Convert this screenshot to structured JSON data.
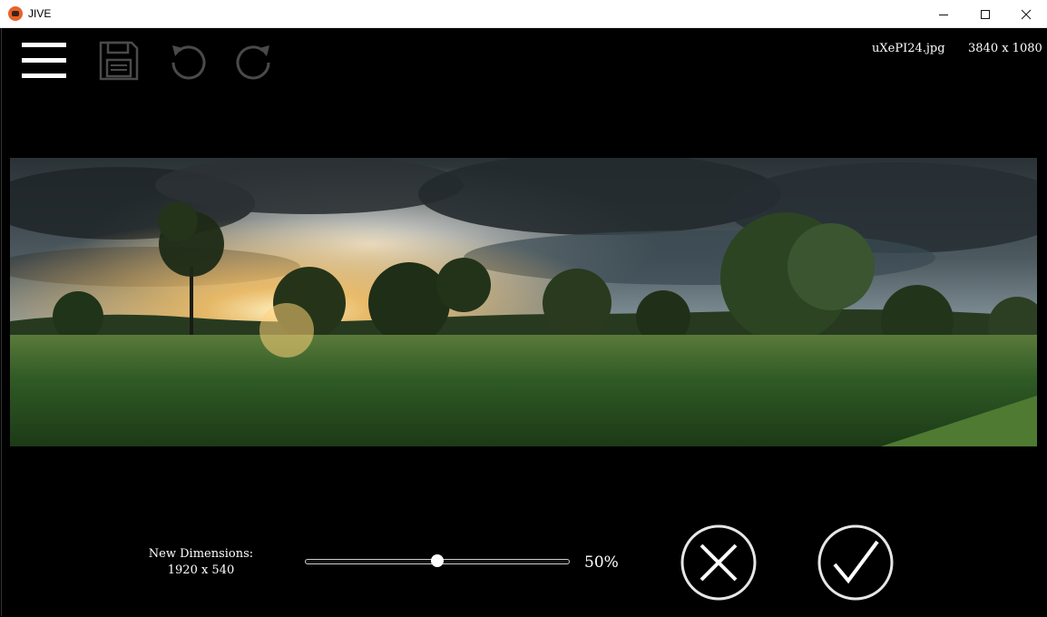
{
  "window": {
    "title": "JIVE",
    "controls": [
      "minimize",
      "maximize",
      "close"
    ]
  },
  "toolbar": {
    "menu_icon": "hamburger-menu-icon",
    "save_icon": "floppy-disk-icon",
    "undo_icon": "rotate-left-icon",
    "redo_icon": "rotate-right-icon"
  },
  "file": {
    "name": "uXePI24.jpg",
    "dimensions": "3840 x 1080"
  },
  "resize": {
    "label": "New Dimensions:",
    "new_dimensions": "1920 x 540",
    "percent_text": "50%",
    "scale_fraction": 0.5
  },
  "actions": {
    "cancel_icon": "cancel-x-icon",
    "confirm_icon": "confirm-check-icon"
  },
  "colors": {
    "background": "#000000",
    "foreground": "#ffffff",
    "app_icon": "#e8622a"
  }
}
